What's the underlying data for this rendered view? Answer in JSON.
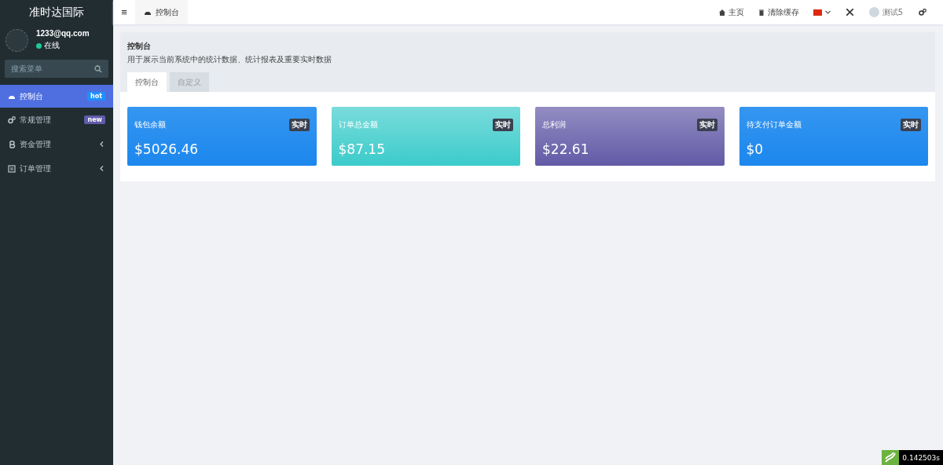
{
  "sidebar": {
    "logo": "准时达国际",
    "user": {
      "email": "1233@qq.com",
      "status": "在线"
    },
    "search": {
      "placeholder": "搜索菜单"
    },
    "items": [
      {
        "label": "控制台",
        "selected": true,
        "badge": {
          "text": "hot",
          "color": "#1e90ff"
        }
      },
      {
        "label": "常规管理",
        "selected": false,
        "badge": {
          "text": "new",
          "color": "#605ca8"
        }
      },
      {
        "label": "资金管理",
        "selected": false,
        "expandable": true
      },
      {
        "label": "订单管理",
        "selected": false,
        "expandable": true
      }
    ]
  },
  "header": {
    "menu_toggle": "≡",
    "tab": "控制台",
    "links": [
      {
        "label": "主页"
      },
      {
        "label": "清除缓存"
      }
    ],
    "username": "测试5"
  },
  "panel": {
    "title": "控制台",
    "description": "用于展示当前系统中的统计数据、统计报表及重要实时数据",
    "tabs": [
      {
        "label": "控制台",
        "selected": true
      },
      {
        "label": "自定义",
        "selected": false
      }
    ],
    "cards": [
      {
        "title": "钱包余额",
        "badge": "实时",
        "value": "$5026.46",
        "kind": "blue"
      },
      {
        "title": "订单总金额",
        "badge": "实时",
        "value": "$87.15",
        "kind": "cyan"
      },
      {
        "title": "总利润",
        "badge": "实时",
        "value": "$22.61",
        "kind": "purple"
      },
      {
        "title": "待支付订单金额",
        "badge": "实时",
        "value": "$0",
        "kind": "blue"
      }
    ]
  },
  "debug_bar": {
    "time": "0.142503s"
  }
}
